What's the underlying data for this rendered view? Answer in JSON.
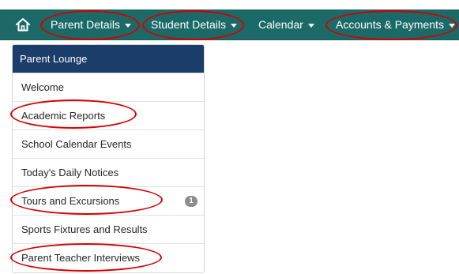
{
  "topnav": {
    "home_icon": "home-icon",
    "items": [
      {
        "label": "Parent Details"
      },
      {
        "label": "Student Details"
      },
      {
        "label": "Calendar"
      },
      {
        "label": "Accounts & Payments"
      }
    ]
  },
  "sidebar": {
    "title": "Parent Lounge",
    "items": [
      {
        "label": "Welcome"
      },
      {
        "label": "Academic Reports"
      },
      {
        "label": "School Calendar Events"
      },
      {
        "label": "Today's Daily Notices"
      },
      {
        "label": "Tours and Excursions",
        "badge": "1"
      },
      {
        "label": "Sports Fixtures and Results"
      },
      {
        "label": "Parent Teacher Interviews"
      }
    ]
  },
  "colors": {
    "nav_bg": "#1b6a68",
    "panel_header_bg": "#1b3d69",
    "annotation_ring": "#d50000",
    "badge_bg": "#8c8c8c"
  }
}
